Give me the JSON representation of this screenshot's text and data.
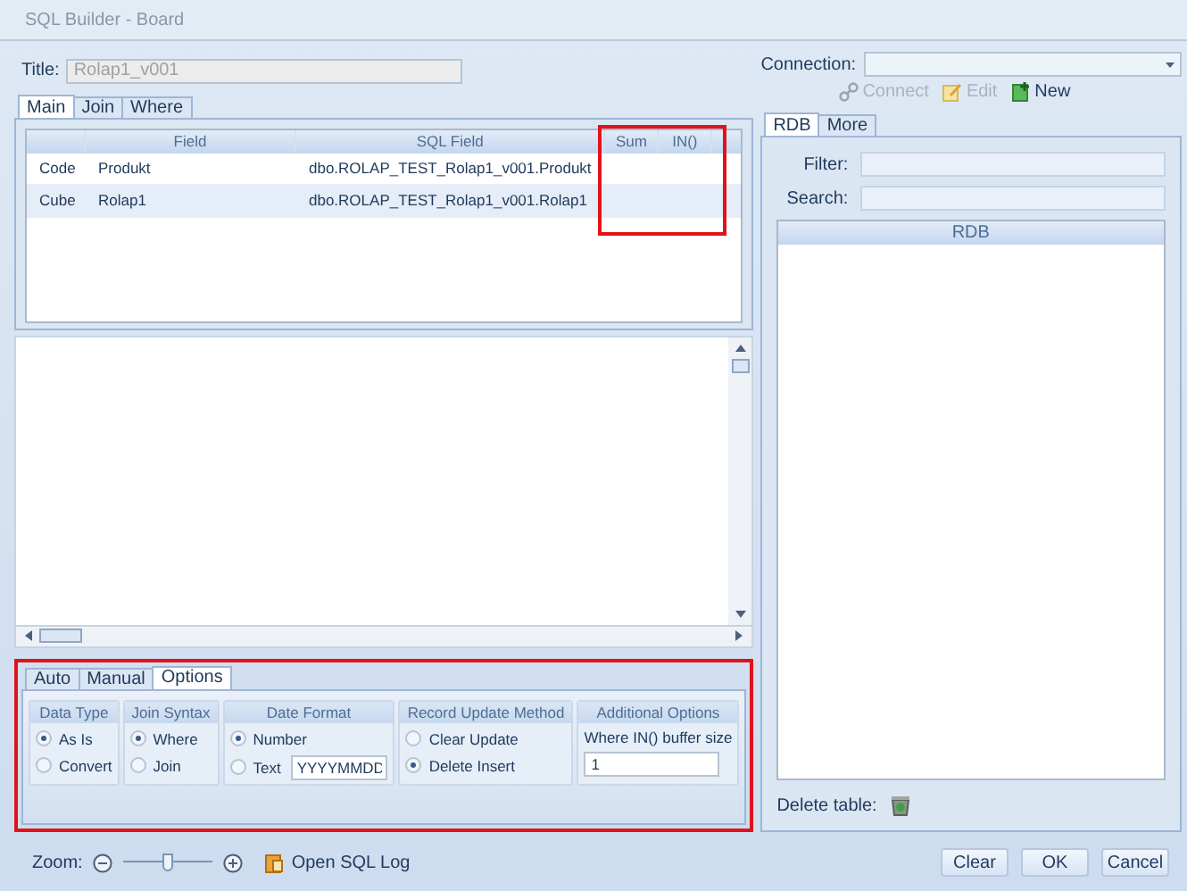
{
  "window": {
    "title": "SQL Builder - Board"
  },
  "title_field": {
    "label": "Title:",
    "value": "Rolap1_v001",
    "disabled": true
  },
  "main_tabs": [
    {
      "label": "Main",
      "selected": true
    },
    {
      "label": "Join",
      "selected": false
    },
    {
      "label": "Where",
      "selected": false
    }
  ],
  "grid": {
    "columns": [
      {
        "label": "Field"
      },
      {
        "label": "SQL Field"
      },
      {
        "label": "Sum"
      },
      {
        "label": "IN()"
      }
    ],
    "rows": [
      {
        "type": "Code",
        "cells": [
          "Produkt",
          "dbo.ROLAP_TEST_Rolap1_v001.Produkt"
        ],
        "selected": false
      },
      {
        "type": "Cube",
        "cells": [
          "Rolap1",
          "dbo.ROLAP_TEST_Rolap1_v001.Rolap1"
        ],
        "selected": true
      }
    ]
  },
  "options_tabs": [
    {
      "label": "Auto",
      "selected": false
    },
    {
      "label": "Manual",
      "selected": false
    },
    {
      "label": "Options",
      "selected": true
    }
  ],
  "option_groups": [
    {
      "kind": "radio",
      "title": "Data Type",
      "options": [
        {
          "label": "As Is",
          "selected": true
        },
        {
          "label": "Convert",
          "selected": false
        }
      ]
    },
    {
      "kind": "radio",
      "title": "Join Syntax",
      "options": [
        {
          "label": "Where",
          "selected": true
        },
        {
          "label": "Join",
          "selected": false
        }
      ]
    },
    {
      "kind": "radio",
      "title": "Date Format",
      "options": [
        {
          "label": "Number",
          "selected": true
        },
        {
          "label": "Text",
          "selected": false,
          "value": "YYYYMMDD"
        }
      ]
    },
    {
      "kind": "radio",
      "title": "Record Update Method",
      "options": [
        {
          "label": "Clear Update",
          "selected": false
        },
        {
          "label": "Delete Insert",
          "selected": true
        }
      ]
    },
    {
      "kind": "input",
      "title": "Additional Options",
      "label": "Where IN() buffer size",
      "value": "1"
    }
  ],
  "connection": {
    "label": "Connection:"
  },
  "connection_actions": [
    {
      "kind": "connect",
      "label": "Connect",
      "disabled": true
    },
    {
      "kind": "edit",
      "label": "Edit",
      "disabled": true
    },
    {
      "kind": "new",
      "label": "New",
      "disabled": false
    }
  ],
  "rdb_tabs": [
    {
      "label": "RDB",
      "selected": true
    },
    {
      "label": "More",
      "selected": false
    }
  ],
  "filter": {
    "label": "Filter:"
  },
  "search": {
    "label": "Search:"
  },
  "rdb_grid": {
    "columns": [
      {
        "label": "RDB"
      }
    ]
  },
  "delete_table": {
    "label": "Delete table:"
  },
  "zoom": {
    "label": "Zoom:",
    "level": 0.5
  },
  "open_sql_log": {
    "label": "Open SQL Log"
  },
  "buttons": [
    {
      "label": "Clear"
    },
    {
      "label": "OK"
    },
    {
      "label": "Cancel"
    }
  ]
}
